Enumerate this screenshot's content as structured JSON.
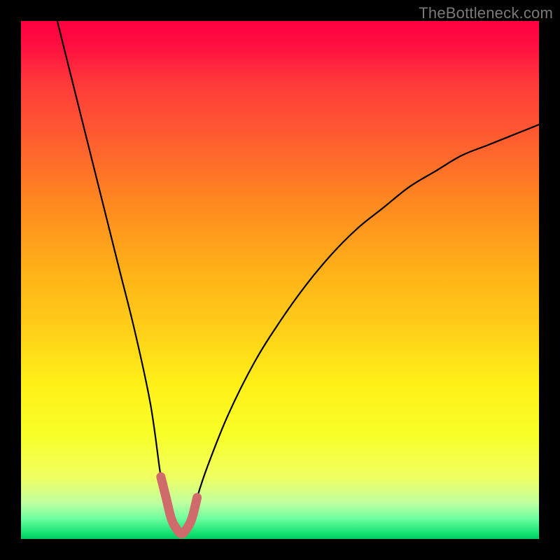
{
  "watermark": "TheBottleneck.com",
  "colors": {
    "page_bg": "#000000",
    "curve_stroke": "#000000",
    "dip_stroke": "#cf6b6b",
    "watermark_color": "#7a7a7a",
    "gradient_stops": [
      {
        "pct": 0,
        "hex": "#ff0040"
      },
      {
        "pct": 5,
        "hex": "#ff1040"
      },
      {
        "pct": 12,
        "hex": "#ff3a3a"
      },
      {
        "pct": 22,
        "hex": "#ff5a30"
      },
      {
        "pct": 35,
        "hex": "#ff8820"
      },
      {
        "pct": 48,
        "hex": "#ffb018"
      },
      {
        "pct": 60,
        "hex": "#ffd018"
      },
      {
        "pct": 70,
        "hex": "#fff018"
      },
      {
        "pct": 80,
        "hex": "#f8ff28"
      },
      {
        "pct": 88,
        "hex": "#f0ff60"
      },
      {
        "pct": 93,
        "hex": "#c0ffa0"
      },
      {
        "pct": 96,
        "hex": "#70ffa0"
      },
      {
        "pct": 99,
        "hex": "#10e070"
      },
      {
        "pct": 100,
        "hex": "#00c860"
      }
    ]
  },
  "chart_data": {
    "type": "line",
    "title": "",
    "xlabel": "",
    "ylabel": "",
    "x_range": [
      0,
      100
    ],
    "y_range": [
      0,
      100
    ],
    "description": "V-shaped bottleneck curve. Value (bottleneck %) falls from ~100 at x≈7 to ~0 near the dip at x≈30, then rises asymptotically toward ~80 by x=100. The red highlighted segment marks the near-zero region (x≈27–34).",
    "series": [
      {
        "name": "bottleneck_curve",
        "x": [
          7,
          10,
          13,
          16,
          19,
          22,
          25,
          27,
          28,
          29,
          30,
          31,
          32,
          33,
          34,
          36,
          40,
          45,
          50,
          55,
          60,
          65,
          70,
          75,
          80,
          85,
          90,
          95,
          100
        ],
        "y": [
          100,
          88,
          76,
          64,
          52,
          40,
          26,
          12,
          8,
          4,
          2,
          1,
          2,
          4,
          8,
          14,
          24,
          34,
          42,
          49,
          55,
          60,
          64,
          68,
          71,
          74,
          76,
          78,
          80
        ]
      }
    ],
    "highlight": {
      "name": "optimal_dip",
      "x": [
        27,
        28,
        29,
        30,
        31,
        32,
        33,
        34
      ],
      "y": [
        12,
        8,
        4,
        2,
        1,
        2,
        4,
        8
      ]
    }
  }
}
